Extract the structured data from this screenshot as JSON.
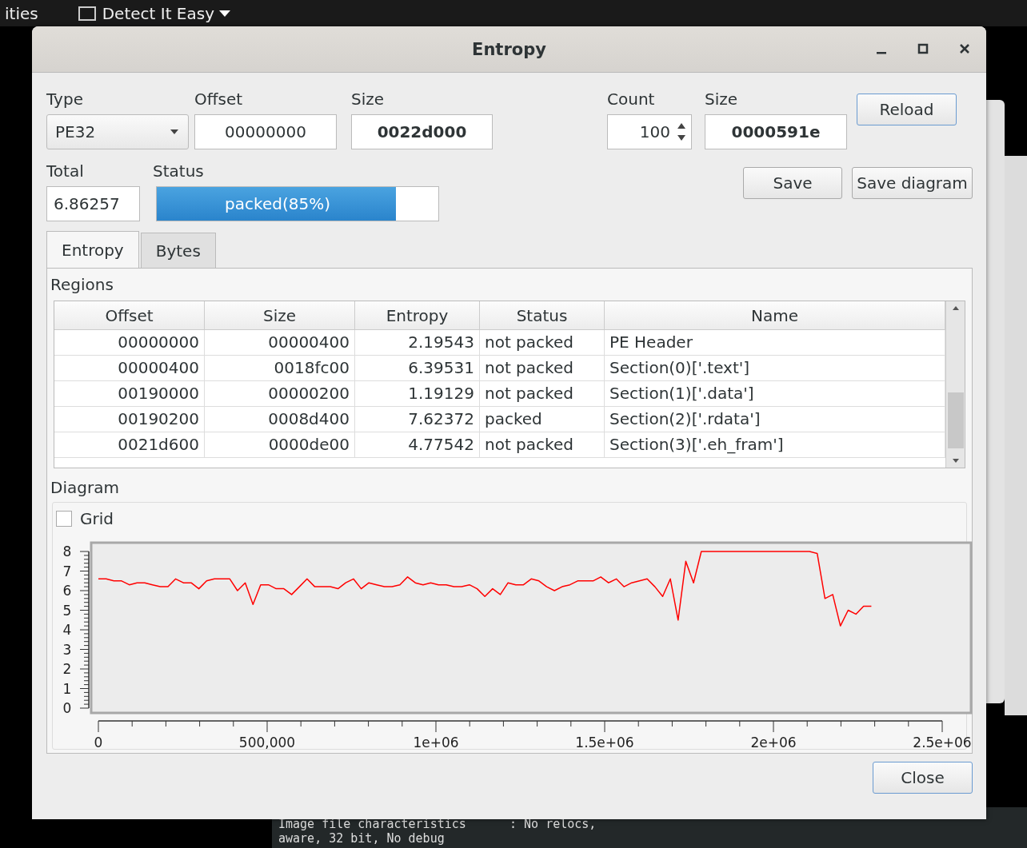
{
  "desktop": {
    "top_bar": [
      "ities",
      "Detect It Easy"
    ],
    "terminal_lines": [
      "Image file characteristics      : No relocs,",
      "aware, 32 bit, No debug"
    ]
  },
  "window": {
    "title": "Entropy"
  },
  "type": {
    "label": "Type",
    "value": "PE32"
  },
  "offset": {
    "label": "Offset",
    "value": "00000000"
  },
  "size": {
    "label": "Size",
    "value": "0022d000"
  },
  "count": {
    "label": "Count",
    "value": "100"
  },
  "region_size": {
    "label": "Size",
    "value": "0000591e"
  },
  "reload_button": "Reload",
  "total": {
    "label": "Total",
    "value": "6.86257"
  },
  "status": {
    "label": "Status",
    "text": "packed(85%)",
    "level": 0.85
  },
  "buttons": [
    "Save",
    "Save diagram"
  ],
  "tabs": [
    {
      "label": "Entropy",
      "selected": true
    },
    {
      "label": "Bytes",
      "selected": false
    }
  ],
  "regions": {
    "title": "Regions",
    "columns": [
      "Offset",
      "Size",
      "Entropy",
      "Status",
      "Name"
    ],
    "rows": [
      [
        "00000000",
        "00000400",
        "2.19543",
        "not packed",
        "PE Header"
      ],
      [
        "00000400",
        "0018fc00",
        "6.39531",
        "not packed",
        "Section(0)['.text']"
      ],
      [
        "00190000",
        "00000200",
        "1.19129",
        "not packed",
        "Section(1)['.data']"
      ],
      [
        "00190200",
        "0008d400",
        "7.62372",
        "packed",
        "Section(2)['.rdata']"
      ],
      [
        "0021d600",
        "0000de00",
        "4.77542",
        "not packed",
        "Section(3)['.eh_fram']"
      ]
    ]
  },
  "diagram": {
    "title": "Diagram",
    "grid": {
      "label": "Grid",
      "checked": false
    },
    "chart_data": {
      "type": "line",
      "xlim": [
        0,
        2500000
      ],
      "ylim": [
        0,
        8
      ],
      "xticks": [
        0,
        {
          "value": 500000,
          "label": "500,000"
        },
        {
          "value": 1000000,
          "label": "1e+06"
        },
        {
          "value": 1500000,
          "label": "1.5e+06"
        },
        {
          "value": 2000000,
          "label": "2e+06"
        },
        {
          "value": 2500000,
          "label": "2.5e+06"
        }
      ],
      "yticks": [
        0,
        1,
        2,
        3,
        4,
        5,
        6,
        7,
        8
      ],
      "series": [
        {
          "color": "#ff0000",
          "values": [
            6.6,
            6.6,
            6.5,
            6.5,
            6.3,
            6.4,
            6.4,
            6.3,
            6.2,
            6.2,
            6.6,
            6.4,
            6.4,
            6.1,
            6.5,
            6.6,
            6.6,
            6.6,
            6.0,
            6.4,
            5.3,
            6.3,
            6.3,
            6.1,
            6.1,
            5.8,
            6.2,
            6.6,
            6.2,
            6.2,
            6.2,
            6.1,
            6.4,
            6.6,
            6.1,
            6.4,
            6.3,
            6.2,
            6.2,
            6.3,
            6.7,
            6.4,
            6.3,
            6.4,
            6.3,
            6.3,
            6.2,
            6.2,
            6.3,
            6.1,
            5.7,
            6.1,
            5.8,
            6.4,
            6.3,
            6.3,
            6.6,
            6.5,
            6.2,
            6.0,
            6.2,
            6.3,
            6.5,
            6.5,
            6.5,
            6.7,
            6.4,
            6.6,
            6.2,
            6.4,
            6.5,
            6.6,
            6.2,
            5.7,
            6.6,
            4.5,
            7.5,
            6.4,
            8.0,
            8.0,
            8.0,
            8.0,
            8.0,
            8.0,
            8.0,
            8.0,
            8.0,
            8.0,
            8.0,
            8.0,
            8.0,
            8.0,
            8.0,
            7.9,
            5.6,
            5.8,
            4.2,
            5.0,
            4.8,
            5.2,
            5.2
          ]
        }
      ],
      "x": [
        0,
        22900,
        45800,
        68700,
        91600,
        114500,
        137400,
        160300,
        183200,
        206100,
        229000,
        251900,
        274800,
        297700,
        320600,
        343500,
        366400,
        389300,
        412200,
        435100,
        458000,
        480900,
        503800,
        526700,
        549600,
        572500,
        595400,
        618300,
        641200,
        664100,
        687000,
        709900,
        732800,
        755700,
        778600,
        801500,
        824400,
        847300,
        870200,
        893100,
        916000,
        938900,
        961800,
        984700,
        1007600,
        1030500,
        1053400,
        1076300,
        1099200,
        1122100,
        1145000,
        1167900,
        1190800,
        1213700,
        1236600,
        1259500,
        1282400,
        1305300,
        1328200,
        1351100,
        1374000,
        1396900,
        1419800,
        1442700,
        1465600,
        1488500,
        1511400,
        1534300,
        1557200,
        1580100,
        1603000,
        1625900,
        1648800,
        1671700,
        1694600,
        1717500,
        1740400,
        1763300,
        1786200,
        1809100,
        1832000,
        1854900,
        1877800,
        1900700,
        1923600,
        1946500,
        1969400,
        1992300,
        2015200,
        2038100,
        2061000,
        2083900,
        2106800,
        2129700,
        2152600,
        2175500,
        2198400,
        2221300,
        2244200,
        2267100,
        2290000
      ]
    }
  },
  "close_button": "Close"
}
